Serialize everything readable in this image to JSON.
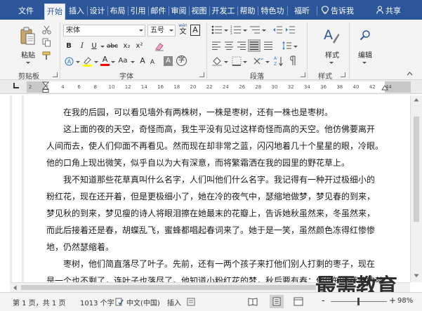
{
  "tabs": [
    "文件",
    "开始",
    "插入",
    "设计",
    "布局",
    "引用",
    "邮件",
    "审阅",
    "视图",
    "开发工具",
    "帮助",
    "特色功能",
    "福昕PDF"
  ],
  "active_tab": "开始",
  "tell_me": "告诉我",
  "share": "共享",
  "clipboard": {
    "paste_label": "粘贴",
    "group_label": "剪贴板"
  },
  "font": {
    "name": "宋体",
    "size": "五号",
    "wen_label": "wén",
    "wen_char": "文",
    "box_char": "A",
    "bold": "B",
    "italic": "I",
    "underline": "U",
    "strike": "abc",
    "sub": "x₂",
    "sup": "x²",
    "grow": "A",
    "shrink": "A",
    "case": "Aa",
    "char_shade": "A",
    "enclose": "字",
    "group_label": "字体"
  },
  "paragraph": {
    "group_label": "段落"
  },
  "styles": {
    "label": "样式",
    "group_label": "样式"
  },
  "editing": {
    "label": "编辑"
  },
  "ruler": {
    "ticks": [
      "2",
      "2",
      "4",
      "6",
      "8",
      "10",
      "12",
      "14",
      "16",
      "18",
      "20",
      "22",
      "24",
      "26",
      "28",
      "30",
      "32",
      "34",
      "36",
      "38",
      "40",
      "42",
      "44"
    ]
  },
  "document": {
    "paragraphs": [
      {
        "lines": [
          "在我的后园，可以看见墙外有两株树，一株是枣树，还有一株也是枣树。"
        ]
      },
      {
        "lines": [
          "这上面的夜的天空，奇怪而高，我生平没有见过这样奇怪而高的天空。他仿佛要离开",
          "人间而去，使人们仰面不再看见。然而现在却非常之蓝，闪闪地着几十个星星的眼，冷眼。",
          "他的口角上现出微笑，似乎自以为大有深意，而将繁霜洒在我的园里的野花草上。"
        ]
      },
      {
        "lines": [
          "我不知道那些花草真叫什么名字，人们叫他们什么名字。我记得有一种开过极细小的",
          "粉红花，现在还开着，但是更极细小了，她在冷的夜气中，瑟缩地做梦，梦见春的到来，",
          "梦见秋的到来，梦见瘦的诗人将眼泪擦在她最末的花瓣上，告诉她秋虽然来，冬虽然来，",
          "而此后接着还是春，胡蝶乱飞，蜜蜂都唱起春词来了。她于是一笑，虽然颜色冻得红惨惨",
          "地，仍然瑟缩着。"
        ]
      },
      {
        "lines": [
          "枣树，他们简直落尽了叶子。先前，还有一两个孩子来打他们别人打剩的枣子，现在",
          "是一个也不剩了，连叶子也落尽了。他知道小粉红花的梦，秋后要有春；他也知道落叶的梦"
        ]
      }
    ]
  },
  "status": {
    "page": "第 1 页，共 1 页",
    "words": "1013 个字",
    "language": "中文(中国)",
    "mode": "插入",
    "zoom": "98%",
    "zoom_minus": "-",
    "zoom_plus": "+"
  },
  "watermark": "最需教育",
  "colors": {
    "brand": "#2b579a",
    "highlight": "#ffff00",
    "font_color": "#ff0000"
  }
}
